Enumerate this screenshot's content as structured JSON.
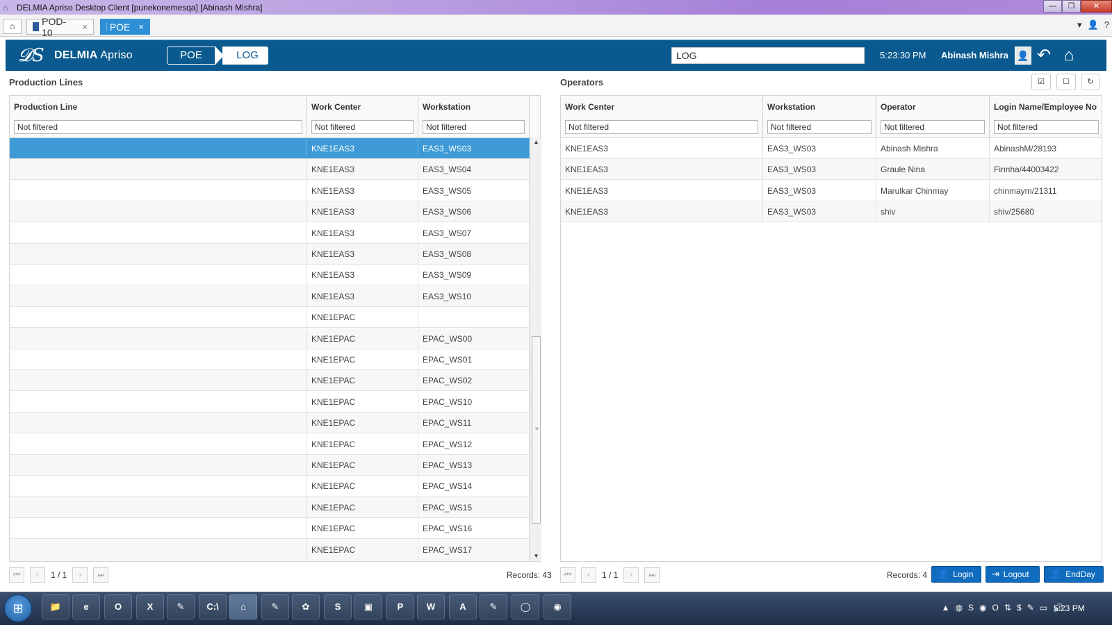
{
  "window": {
    "title": "DELMIA Apriso Desktop Client [punekonemesqa] [Abinash Mishra]",
    "controls": [
      "—",
      "❐",
      "✕"
    ]
  },
  "tabs": [
    {
      "label": "POD-10",
      "close": "×"
    },
    {
      "label": "POE",
      "close": "×"
    }
  ],
  "header": {
    "logo": "𝓓S",
    "brand_bold": "DELMIA",
    "brand_light": " Apriso",
    "crumbs": [
      "POE",
      "LOG"
    ],
    "search_value": "LOG",
    "time": "5:23:30 PM",
    "user": "Abinash Mishra"
  },
  "production_lines": {
    "title": "Production Lines",
    "columns": [
      "Production Line",
      "Work Center",
      "Workstation"
    ],
    "filter_placeholder": "Not filtered",
    "rows": [
      [
        "",
        "KNE1EAS3",
        "EAS3_WS03"
      ],
      [
        "",
        "KNE1EAS3",
        "EAS3_WS04"
      ],
      [
        "",
        "KNE1EAS3",
        "EAS3_WS05"
      ],
      [
        "",
        "KNE1EAS3",
        "EAS3_WS06"
      ],
      [
        "",
        "KNE1EAS3",
        "EAS3_WS07"
      ],
      [
        "",
        "KNE1EAS3",
        "EAS3_WS08"
      ],
      [
        "",
        "KNE1EAS3",
        "EAS3_WS09"
      ],
      [
        "",
        "KNE1EAS3",
        "EAS3_WS10"
      ],
      [
        "",
        "KNE1EPAC",
        ""
      ],
      [
        "",
        "KNE1EPAC",
        "EPAC_WS00"
      ],
      [
        "",
        "KNE1EPAC",
        "EPAC_WS01"
      ],
      [
        "",
        "KNE1EPAC",
        "EPAC_WS02"
      ],
      [
        "",
        "KNE1EPAC",
        "EPAC_WS10"
      ],
      [
        "",
        "KNE1EPAC",
        "EPAC_WS11"
      ],
      [
        "",
        "KNE1EPAC",
        "EPAC_WS12"
      ],
      [
        "",
        "KNE1EPAC",
        "EPAC_WS13"
      ],
      [
        "",
        "KNE1EPAC",
        "EPAC_WS14"
      ],
      [
        "",
        "KNE1EPAC",
        "EPAC_WS15"
      ],
      [
        "",
        "KNE1EPAC",
        "EPAC_WS16"
      ],
      [
        "",
        "KNE1EPAC",
        "EPAC_WS17"
      ]
    ],
    "pager": "1 / 1",
    "records": "Records: 43"
  },
  "operators": {
    "title": "Operators",
    "columns": [
      "Work Center",
      "Workstation",
      "Operator",
      "Login Name/Employee No"
    ],
    "filter_placeholder": "Not filtered",
    "rows": [
      [
        "KNE1EAS3",
        "EAS3_WS03",
        "Abinash Mishra",
        "AbinashM/28193"
      ],
      [
        "KNE1EAS3",
        "EAS3_WS03",
        "Graule Nina",
        "Finnha/44003422"
      ],
      [
        "KNE1EAS3",
        "EAS3_WS03",
        "Marulkar Chinmay",
        "chinmaym/21311"
      ],
      [
        "KNE1EAS3",
        "EAS3_WS03",
        "shiv",
        "shiv/25680"
      ]
    ],
    "pager": "1 / 1",
    "records": "Records: 4",
    "actions": {
      "login": "Login",
      "logout": "Logout",
      "endday": "EndDay"
    }
  },
  "taskbar": {
    "clock": "5:23 PM",
    "items": [
      "📁",
      "e",
      "O",
      "X",
      "✎",
      "C:\\",
      "⌂",
      "✎",
      "✿",
      "S",
      "▣",
      "P",
      "W",
      "A",
      "✎",
      "◯",
      "◉"
    ]
  },
  "icons": {
    "home": "home-icon",
    "user": "user-icon",
    "help": "help-icon",
    "back": "back-icon",
    "check": "check-icon",
    "square": "square-icon",
    "refresh": "refresh-icon"
  },
  "colors": {
    "header": "#0a5a8f",
    "selected_row": "#3d9ad6",
    "active_tab": "#2f8fd6",
    "action_button": "#0f6cbf"
  }
}
